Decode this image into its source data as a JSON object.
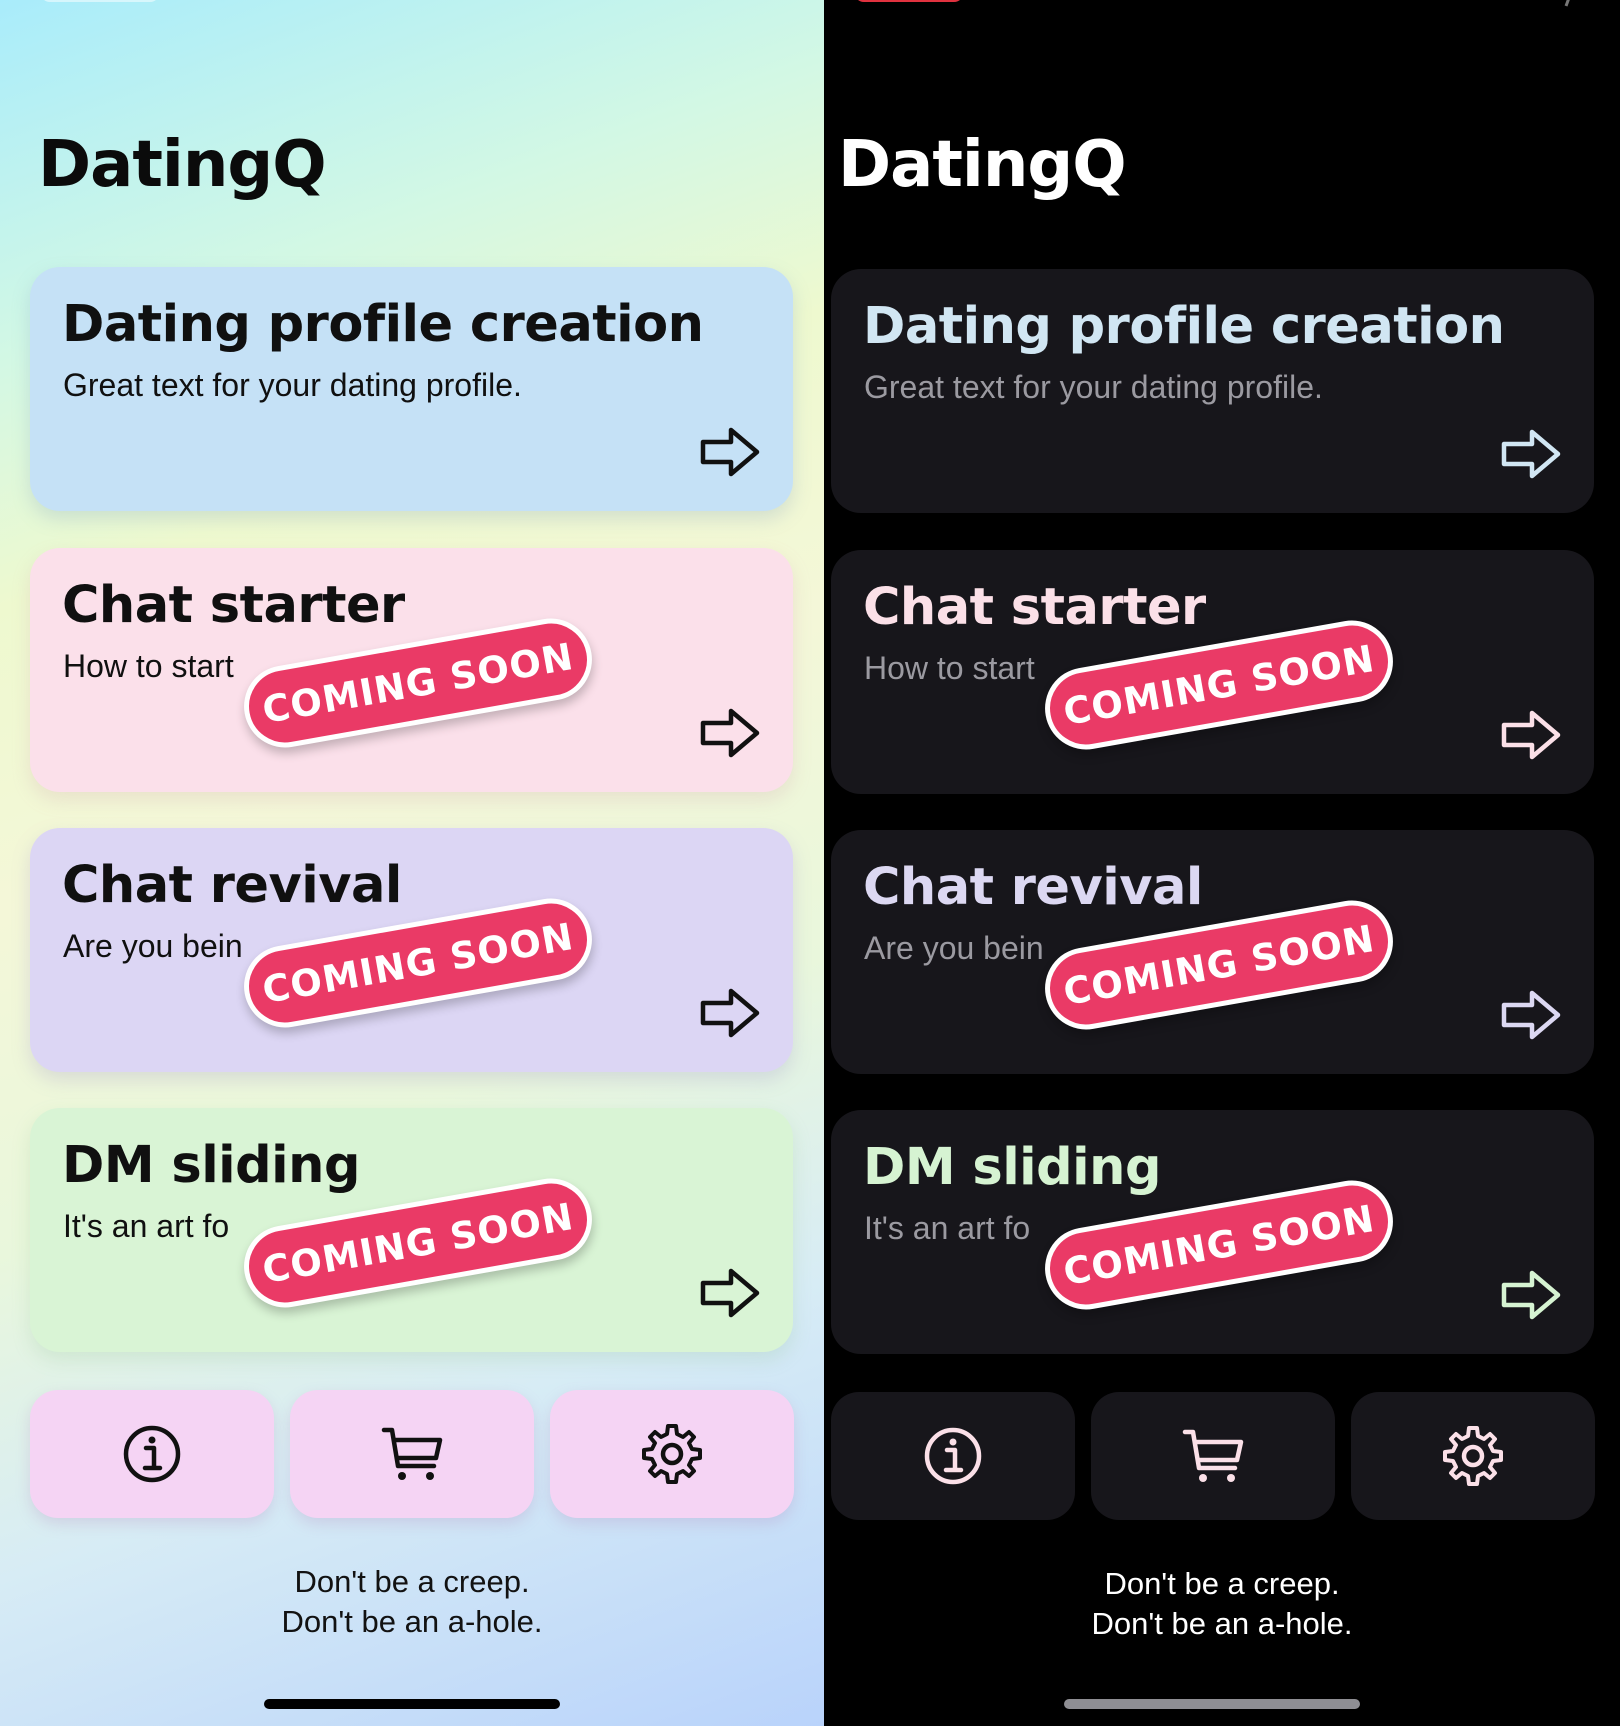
{
  "app": {
    "title": "DatingQ"
  },
  "cards": [
    {
      "title": "Dating profile creation",
      "subtitle": "Great text for your dating profile.",
      "badge": ""
    },
    {
      "title": "Chat starter",
      "subtitle": "How to start",
      "badge": "COMING SOON"
    },
    {
      "title": "Chat revival",
      "subtitle": "Are you bein",
      "badge": "COMING SOON"
    },
    {
      "title": "DM sliding",
      "subtitle": "It's an art fo",
      "badge": "COMING SOON"
    }
  ],
  "icons": {
    "card_action": "arrow-right-icon",
    "toolbar": [
      "info-icon",
      "cart-icon",
      "gear-icon"
    ]
  },
  "footer": {
    "line1": "Don't be a creep.",
    "line2": "Don't be an a-hole."
  },
  "themes": {
    "light": {
      "accent": "#ea3a66"
    },
    "dark": {
      "accent": "#ea3a66",
      "card_background": "#17161b"
    }
  }
}
